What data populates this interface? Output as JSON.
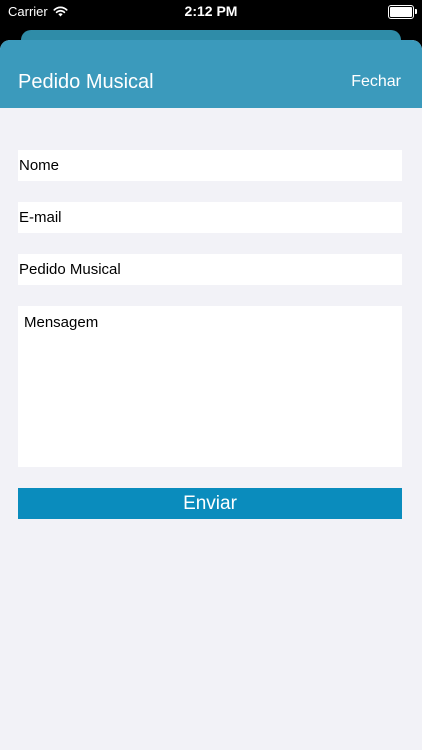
{
  "status_bar": {
    "carrier": "Carrier",
    "time": "2:12 PM",
    "wifi_icon": "wifi-icon",
    "battery_icon": "battery-icon"
  },
  "colors": {
    "nav_background": "#3b9abc",
    "button_background": "#0a8cbd",
    "page_background": "#f2f2f7"
  },
  "nav": {
    "title": "Pedido Musical",
    "close_label": "Fechar"
  },
  "form": {
    "name_placeholder": "Nome",
    "email_placeholder": "E-mail",
    "request_placeholder": "Pedido Musical",
    "message_placeholder": "Mensagem",
    "submit_label": "Enviar"
  }
}
